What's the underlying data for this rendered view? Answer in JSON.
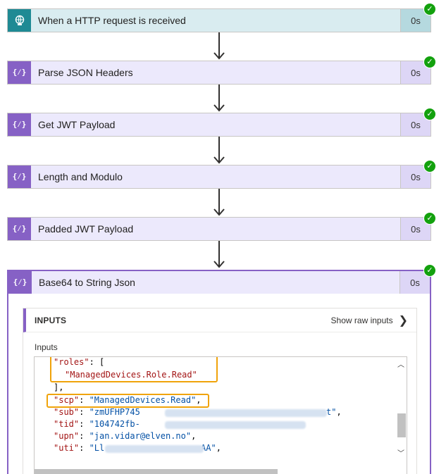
{
  "steps": [
    {
      "title": "When a HTTP request is received",
      "duration": "0s",
      "icon": "globe-icon"
    },
    {
      "title": "Parse JSON Headers",
      "duration": "0s",
      "icon": "curly-braces-icon"
    },
    {
      "title": "Get JWT Payload",
      "duration": "0s",
      "icon": "curly-braces-icon"
    },
    {
      "title": "Length and Modulo",
      "duration": "0s",
      "icon": "curly-braces-icon"
    },
    {
      "title": "Padded JWT Payload",
      "duration": "0s",
      "icon": "curly-braces-icon"
    }
  ],
  "expanded": {
    "title": "Base64 to String Json",
    "duration": "0s",
    "icon": "curly-braces-icon",
    "inputs_header": "INPUTS",
    "show_raw": "Show raw inputs",
    "inputs_label": "Inputs",
    "code": {
      "roles_key": "\"roles\"",
      "roles_value": "\"ManagedDevices.Role.Read\"",
      "scp_key": "\"scp\"",
      "scp_value": "\"ManagedDevices.Read\"",
      "sub_key": "\"sub\"",
      "sub_value": "\"zmUFHP745",
      "sub_value_end": "t\"",
      "tid_key": "\"tid\"",
      "tid_value": "\"104742fb-",
      "upn_key": "\"upn\"",
      "upn_value": "\"jan.vidar@elven.no\"",
      "uti_key": "\"uti\"",
      "uti_value": "\"Ll",
      "uti_value_end": "AA\""
    }
  },
  "colors": {
    "trigger_accent": "#1f8a94",
    "compose_accent": "#8661c5",
    "success": "#13a10e",
    "highlight": "#f0a30a"
  }
}
